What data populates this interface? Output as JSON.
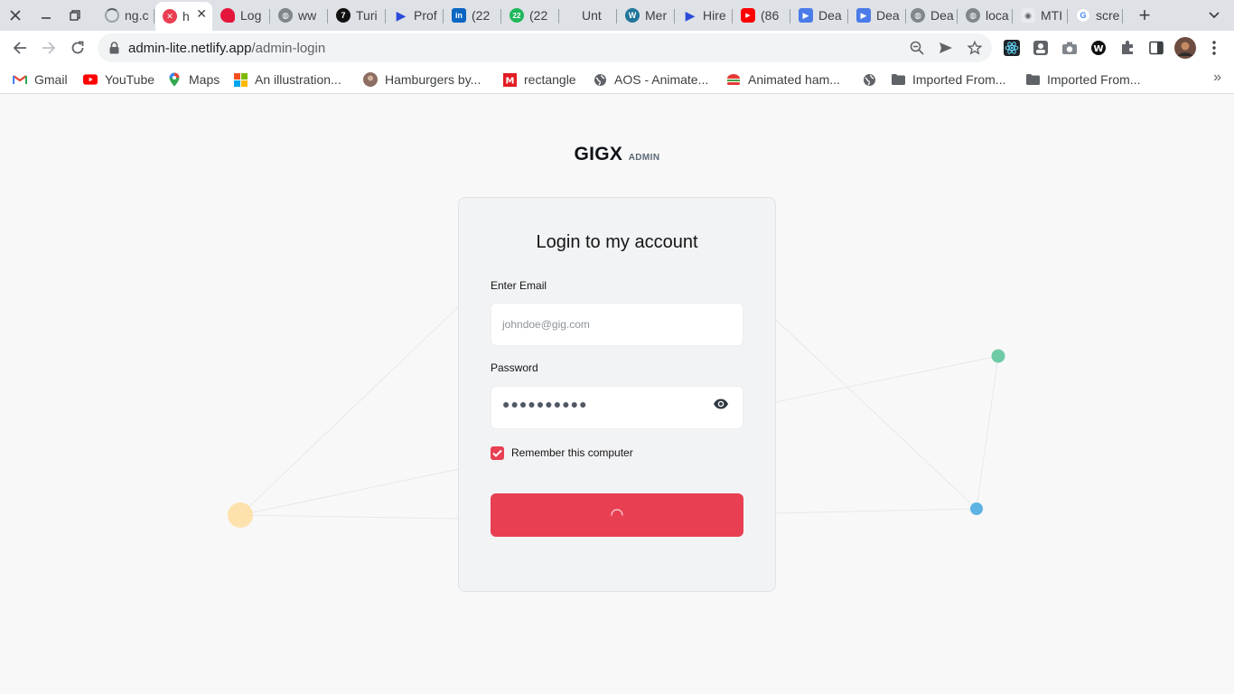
{
  "browser": {
    "window_controls": {
      "close_icon": "close-icon",
      "minimize_icon": "minimize-icon",
      "restore_icon": "restore-icon"
    },
    "tabs": [
      {
        "label": "ng.c",
        "favicon": "loading-spinner",
        "active": false
      },
      {
        "label": "h",
        "favicon": "red-x-logo",
        "active": true
      },
      {
        "label": "Log",
        "favicon": "red-heart-logo",
        "active": false
      },
      {
        "label": "ww",
        "favicon": "globe-icon",
        "active": false
      },
      {
        "label": "Turi",
        "favicon": "black-7-logo",
        "active": false
      },
      {
        "label": "Prof",
        "favicon": "blue-flag-logo",
        "active": false
      },
      {
        "label": "(22",
        "favicon": "linkedin-logo",
        "active": false
      },
      {
        "label": "(22",
        "favicon": "green-22-badge",
        "active": false
      },
      {
        "label": "Unt",
        "favicon": "none",
        "active": false
      },
      {
        "label": "Mer",
        "favicon": "wordpress-logo",
        "active": false
      },
      {
        "label": "Hire",
        "favicon": "blue-flag-logo",
        "active": false
      },
      {
        "label": "(86",
        "favicon": "youtube-logo",
        "active": false
      },
      {
        "label": "Dea",
        "favicon": "blue-play-logo",
        "active": false
      },
      {
        "label": "Dea",
        "favicon": "blue-play-logo",
        "active": false
      },
      {
        "label": "Dea",
        "favicon": "globe-icon",
        "active": false
      },
      {
        "label": "loca",
        "favicon": "globe-icon",
        "active": false
      },
      {
        "label": "MTI",
        "favicon": "eye-logo",
        "active": false
      },
      {
        "label": "scre",
        "favicon": "google-logo",
        "active": false
      }
    ],
    "url_host": "admin-lite.netlify.app",
    "url_path": "/admin-login",
    "bookmarks": [
      {
        "label": "Gmail",
        "icon": "gmail-icon"
      },
      {
        "label": "YouTube",
        "icon": "youtube-icon"
      },
      {
        "label": "Maps",
        "icon": "maps-pin-icon"
      },
      {
        "label": "An illustration...",
        "icon": "microsoft-icon"
      },
      {
        "label": "Hamburgers by...",
        "icon": "avatar-icon"
      },
      {
        "label": "rectangle",
        "icon": "red-m-icon"
      },
      {
        "label": "AOS - Animate...",
        "icon": "globe-icon"
      },
      {
        "label": "Animated ham...",
        "icon": "burger-icon"
      },
      {
        "label": "",
        "icon": "globe-icon"
      },
      {
        "label": "Imported From...",
        "icon": "folder-icon"
      },
      {
        "label": "Imported From...",
        "icon": "folder-icon"
      }
    ]
  },
  "brand": {
    "name": "GIGX",
    "sub": "ADMIN"
  },
  "login": {
    "title": "Login to my account",
    "email_label": "Enter Email",
    "email_placeholder": "johndoe@gig.com",
    "password_label": "Password",
    "password_masked": "●●●●●●●●●●",
    "remember_label": "Remember this computer",
    "remember_checked": true,
    "submit_state": "loading"
  },
  "colors": {
    "accent": "#e93f52",
    "card_bg": "#f2f3f5",
    "page_bg": "#f8f8f8",
    "node_orange": "#fde2ad",
    "node_green": "#6fcba6",
    "node_blue": "#5db3e3"
  }
}
